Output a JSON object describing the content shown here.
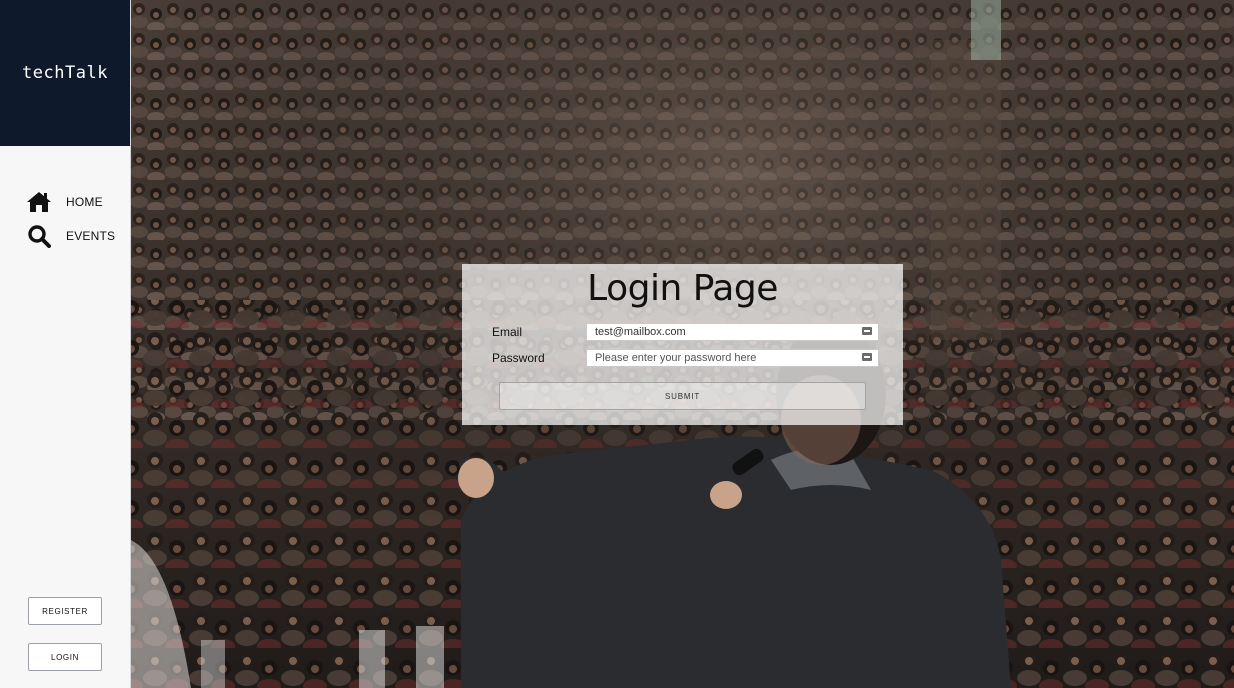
{
  "brand": {
    "name": "techTalk"
  },
  "nav": {
    "items": [
      {
        "label": "HOME",
        "icon": "home-icon"
      },
      {
        "label": "EVENTS",
        "icon": "search-icon"
      }
    ]
  },
  "sidebar_buttons": {
    "register_label": "REGISTER",
    "login_label": "LOGIN"
  },
  "login": {
    "title": "Login Page",
    "email_label": "Email",
    "email_value": "test@mailbox.com",
    "password_label": "Password",
    "password_placeholder": "Please enter your password here",
    "submit_label": "SUBMIT"
  },
  "colors": {
    "brand_bg": "#0e1a2b",
    "sidebar_bg": "#f7f7f7",
    "card_bg": "rgba(255,255,255,0.72)"
  }
}
